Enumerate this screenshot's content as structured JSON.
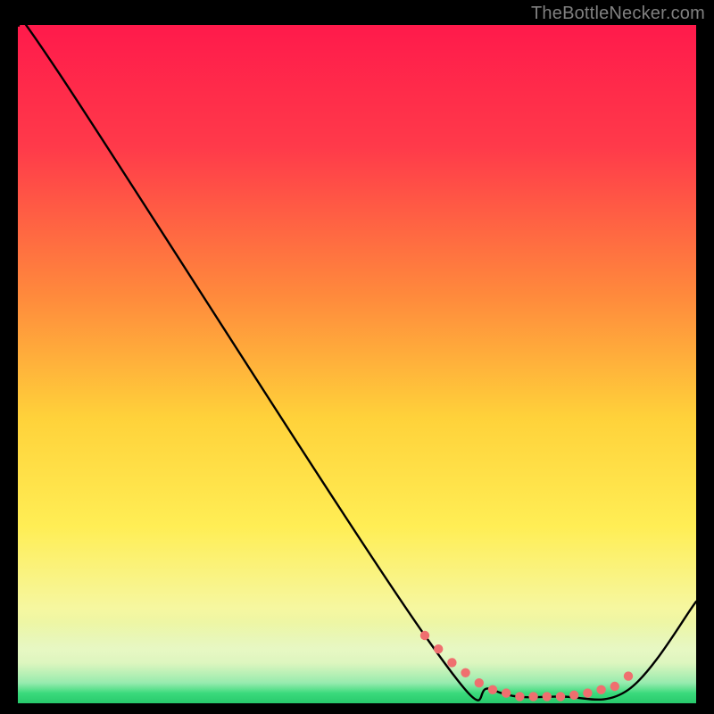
{
  "attribution": "TheBottleNecker.com",
  "colors": {
    "bg": "#000000",
    "grad_top": "#ff1a4b",
    "grad_mid": "#ffde33",
    "grad_bot_green": "#33e07a",
    "grad_bot_edge": "#9be8b8",
    "curve": "#000000",
    "dots": "#ef6f6f"
  },
  "chart_data": {
    "type": "line",
    "title": "",
    "xlabel": "",
    "ylabel": "",
    "xlim": [
      0,
      100
    ],
    "ylim": [
      0,
      100
    ],
    "series": [
      {
        "name": "curve",
        "x": [
          0,
          6,
          60,
          70,
          80,
          90,
          100
        ],
        "y": [
          100,
          93,
          10,
          2,
          1,
          2,
          15
        ]
      }
    ],
    "dots": {
      "x": [
        60,
        62,
        64,
        66,
        68,
        70,
        72,
        74,
        76,
        78,
        80,
        82,
        84,
        86,
        88,
        90
      ],
      "y": [
        10,
        8,
        6,
        4.5,
        3,
        2,
        1.5,
        1,
        1,
        1,
        1,
        1.2,
        1.5,
        2,
        2.5,
        4
      ]
    },
    "annotations": []
  }
}
